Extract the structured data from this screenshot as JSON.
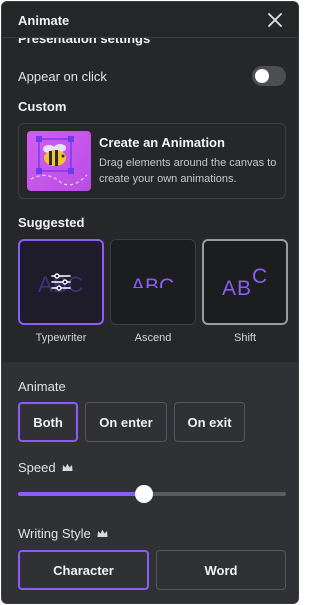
{
  "header": {
    "title": "Animate"
  },
  "presentation": {
    "heading": "Presentation settings",
    "appear_label": "Appear on click",
    "appear_on": false
  },
  "custom": {
    "heading": "Custom",
    "card_title": "Create an Animation",
    "card_desc_1": "Drag elements around the canvas to",
    "card_desc_2": "create your own animations."
  },
  "suggested": {
    "heading": "Suggested",
    "tiles": [
      {
        "label": "Typewriter",
        "selected": true
      },
      {
        "label": "Ascend",
        "selected": false
      },
      {
        "label": "Shift",
        "selected": false
      }
    ]
  },
  "animate": {
    "heading": "Animate",
    "options": [
      "Both",
      "On enter",
      "On exit"
    ],
    "selected": "Both"
  },
  "speed": {
    "label": "Speed",
    "value": 0.47
  },
  "writing_style": {
    "label": "Writing Style",
    "options": [
      "Character",
      "Word"
    ],
    "selected": "Character"
  },
  "colors": {
    "accent": "#8b5cf6",
    "panel": "#252627",
    "bottom_panel": "#303134"
  }
}
